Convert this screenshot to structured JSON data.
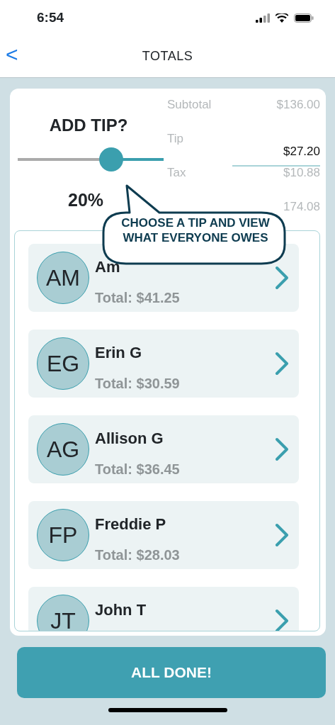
{
  "status_bar": {
    "time": "6:54"
  },
  "nav": {
    "back": "<",
    "title": "TOTALS"
  },
  "tip": {
    "heading": "ADD TIP?",
    "level": 0.64,
    "percent": "20%"
  },
  "summary": [
    {
      "kind": "line",
      "label": "Subtotal",
      "value": "$136.00"
    },
    {
      "kind": "field",
      "label": "Tip",
      "value": "$27.20"
    },
    {
      "kind": "line",
      "label": "Tax",
      "value": "$10.88"
    },
    {
      "kind": "line",
      "value": "174.08"
    }
  ],
  "callout": "CHOOSE A TIP AND VIEW WHAT EVERYONE OWES",
  "people": [
    {
      "initials": "AM",
      "name": "Am",
      "total": "Total: $41.25"
    },
    {
      "initials": "EG",
      "name": "Erin G",
      "total": "Total: $30.59"
    },
    {
      "initials": "AG",
      "name": "Allison G",
      "total": "Total: $36.45"
    },
    {
      "initials": "FP",
      "name": "Freddie P",
      "total": "Total: $28.03"
    },
    {
      "initials": "JT",
      "name": "John T"
    }
  ],
  "done_button": "ALL DONE!"
}
